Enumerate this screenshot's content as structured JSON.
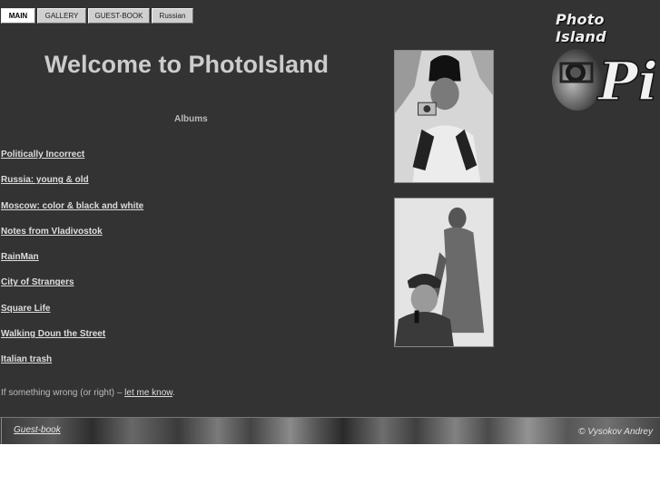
{
  "nav": {
    "items": [
      {
        "label": "MAIN",
        "active": true
      },
      {
        "label": "GALLERY",
        "active": false
      },
      {
        "label": "GUEST-BOOK",
        "active": false
      },
      {
        "label": "Russian",
        "active": false
      }
    ]
  },
  "logo": {
    "text": "Photo Island",
    "monogram": "Pi"
  },
  "welcome": {
    "title": "Welcome to PhotoIsland"
  },
  "albums": {
    "heading": "Albums",
    "items": [
      "Politically Incorrect",
      "Russia: young & old",
      "Moscow: color & black and white",
      "Notes from Vladivostok",
      "RainMan",
      "City of Strangers",
      "Square Life",
      "Walking Doun the Street",
      "Italian trash"
    ]
  },
  "feedback": {
    "prefix": "If something wrong (or right) – ",
    "link": "let me know",
    "suffix": "."
  },
  "footer": {
    "guestbook": "Guest-book",
    "copyright": "© Vysokov Andrey"
  }
}
